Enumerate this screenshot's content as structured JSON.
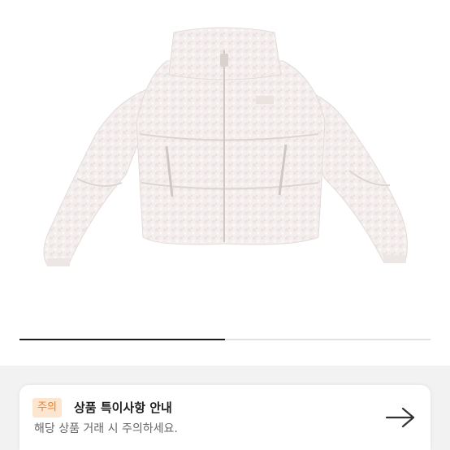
{
  "product": {
    "image_alt": "white fleece puffer jacket",
    "carousel_progress": 0.5
  },
  "notice": {
    "badge": "주의",
    "title": "상품 특이사항 안내",
    "subtitle": "해당 상품 거래 시 주의하세요.",
    "arrow_icon": "arrow-right-icon"
  },
  "colors": {
    "badge_bg": "#fde6cf",
    "badge_text": "#f47c20",
    "progress": "#1a1a1a"
  }
}
